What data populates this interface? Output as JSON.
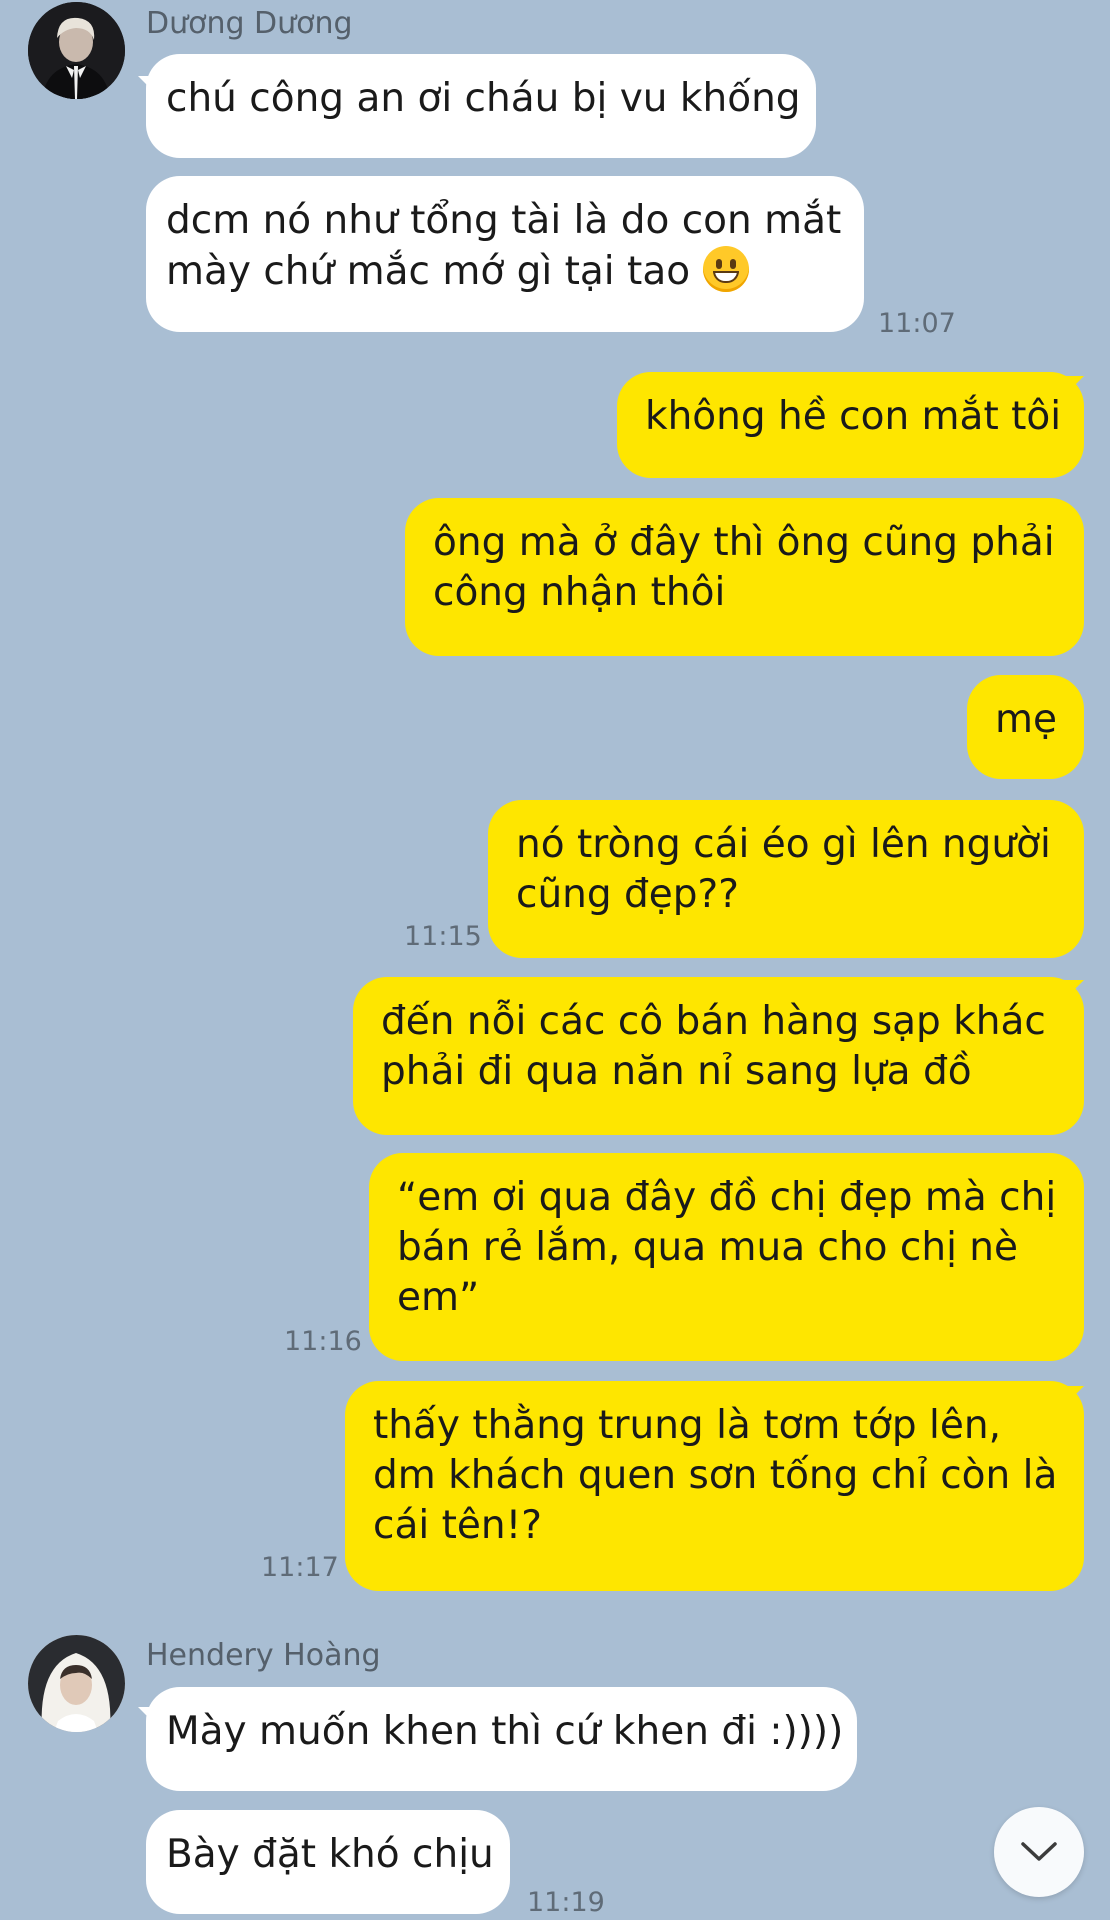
{
  "colors": {
    "background": "#a9bed3",
    "incoming_bubble": "#ffffff",
    "outgoing_bubble": "#fee600",
    "timestamp": "#5f6b77",
    "sender_name": "#55606b"
  },
  "thread1": {
    "sender": "Dương Dương",
    "avatar": "avatar-photo",
    "messages": [
      {
        "lines": [
          "chú công an ơi cháu bị vu khống"
        ]
      },
      {
        "lines": [
          "dcm nó như tổng tài là do con mắt",
          "mày chứ mắc mớ gì tại tao"
        ],
        "emoji": "grinning-face-emoji",
        "time": "11:07"
      }
    ]
  },
  "outgoing": [
    {
      "lines": [
        "không hề con mắt tôi"
      ]
    },
    {
      "lines": [
        "ông mà ở đây thì ông cũng phải",
        "công nhận thôi"
      ]
    },
    {
      "lines": [
        "mẹ"
      ]
    },
    {
      "lines": [
        "nó tròng cái éo gì lên người",
        "cũng đẹp??"
      ],
      "time": "11:15"
    },
    {
      "lines": [
        "đến nỗi các cô bán hàng sạp khác",
        "phải đi qua năn nỉ sang lựa đồ"
      ]
    },
    {
      "lines": [
        "“em ơi qua đây đồ chị đẹp mà chị",
        "bán rẻ lắm, qua mua cho chị nè",
        "em”"
      ],
      "time": "11:16"
    },
    {
      "lines": [
        "thấy thằng trung là tơm tớp lên,",
        "dm khách quen sơn tống chỉ còn là",
        "cái tên!?"
      ],
      "time": "11:17"
    }
  ],
  "thread2": {
    "sender": "Hendery Hoàng",
    "avatar": "avatar-photo",
    "messages": [
      {
        "lines": [
          "Mày muốn khen thì cứ khen đi :))))"
        ]
      },
      {
        "lines": [
          "Bày đặt khó chịu"
        ],
        "time": "11:19"
      }
    ]
  },
  "scroll_button_icon": "chevron-down-icon"
}
